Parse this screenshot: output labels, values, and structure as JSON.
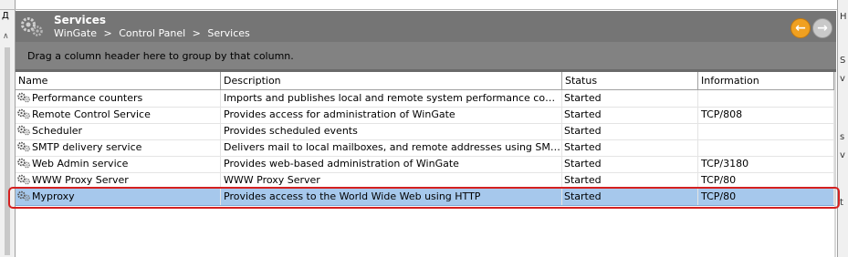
{
  "header": {
    "title": "Services",
    "breadcrumb": [
      "WinGate",
      ">",
      "Control Panel",
      ">",
      "Services"
    ]
  },
  "group_hint": "Drag a column header here to group by that column.",
  "columns": [
    "Name",
    "Description",
    "Status",
    "Information"
  ],
  "rows": [
    {
      "name": "Performance counters",
      "description": "Imports and publishes local and remote system performance counters for d...",
      "status": "Started",
      "info": ""
    },
    {
      "name": "Remote Control Service",
      "description": "Provides access for administration of WinGate",
      "status": "Started",
      "info": "TCP/808"
    },
    {
      "name": "Scheduler",
      "description": "Provides scheduled events",
      "status": "Started",
      "info": ""
    },
    {
      "name": "SMTP delivery service",
      "description": "Delivers mail to local mailboxes, and remote addresses using SMTP",
      "status": "Started",
      "info": ""
    },
    {
      "name": "Web Admin service",
      "description": "Provides web-based administration of WinGate",
      "status": "Started",
      "info": "TCP/3180"
    },
    {
      "name": "WWW Proxy Server",
      "description": "WWW Proxy Server",
      "status": "Started",
      "info": "TCP/80"
    },
    {
      "name": "Myproxy",
      "description": "Provides access to the World Wide Web using HTTP",
      "status": "Started",
      "info": "TCP/80"
    }
  ],
  "selected_row_index": 6,
  "left_strip": {
    "pin_glyph": "Д",
    "up_glyph": "∧"
  },
  "right_strip_glyphs": [
    "H",
    "S",
    "v",
    "s",
    "v",
    "t"
  ],
  "icons": {
    "logo": "gears-logo-icon",
    "back": "back-arrow-icon",
    "forward": "forward-arrow-icon",
    "row": "gear-service-icon"
  },
  "colors": {
    "header_bg": "#757575",
    "group_band_bg": "#828282",
    "selected_row": "#a6c8ec",
    "highlight_outline": "#d42020",
    "back_button": "#f0a020"
  }
}
